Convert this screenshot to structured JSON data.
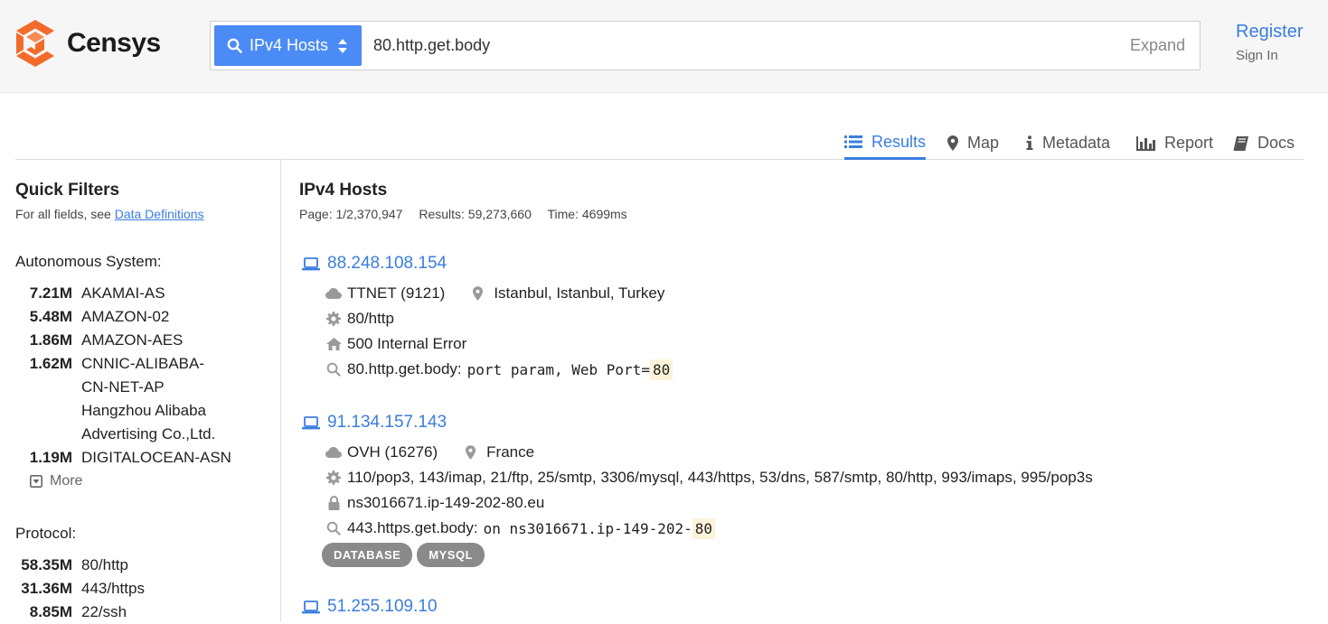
{
  "brand": {
    "name": "Censys",
    "colors": {
      "orange": "#f26b2b",
      "blue": "#4a8bf5",
      "link": "#3a7de0"
    }
  },
  "search": {
    "index_label": "IPv4 Hosts",
    "query": "80.http.get.body",
    "expand_label": "Expand"
  },
  "auth": {
    "register": "Register",
    "sign_in": "Sign In"
  },
  "tabs": [
    {
      "label": "Results",
      "icon": "list-icon",
      "active": true
    },
    {
      "label": "Map",
      "icon": "map-marker-icon"
    },
    {
      "label": "Metadata",
      "icon": "info-icon"
    },
    {
      "label": "Report",
      "icon": "bar-chart-icon"
    },
    {
      "label": "Docs",
      "icon": "book-icon"
    }
  ],
  "sidebar": {
    "title": "Quick Filters",
    "subtitle_prefix": "For all fields, see",
    "subtitle_link": "Data Definitions",
    "autonomous_system": {
      "title": "Autonomous System:",
      "items": [
        {
          "count": "7.21M",
          "name": "AKAMAI-AS"
        },
        {
          "count": "5.48M",
          "name": "AMAZON-02"
        },
        {
          "count": "1.86M",
          "name": "AMAZON-AES"
        },
        {
          "count": "1.62M",
          "name": "CNNIC-ALIBABA-CN-NET-AP Hangzhou Alibaba Advertising Co.,Ltd."
        },
        {
          "count": "1.19M",
          "name": "DIGITALOCEAN-ASN"
        }
      ],
      "more_label": "More"
    },
    "protocol": {
      "title": "Protocol:",
      "items": [
        {
          "count": "58.35M",
          "name": "80/http"
        },
        {
          "count": "31.36M",
          "name": "443/https"
        },
        {
          "count": "8.85M",
          "name": "22/ssh"
        }
      ]
    }
  },
  "main": {
    "title": "IPv4 Hosts",
    "page": "Page: 1/2,370,947",
    "results": "Results: 59,273,660",
    "time": "Time: 4699ms",
    "results_list": [
      {
        "ip": "88.248.108.154",
        "as": "TTNET (9121)",
        "location": "Istanbul, Istanbul, Turkey",
        "protocols": "80/http",
        "title": "500 Internal Error",
        "match_field": "80.http.get.body:",
        "match_text": "port param, Web Port=",
        "match_highlight": "80"
      },
      {
        "ip": "91.134.157.143",
        "as": "OVH (16276)",
        "location": "France",
        "protocols": "110/pop3, 143/imap, 21/ftp, 25/smtp, 3306/mysql, 443/https, 53/dns, 587/smtp, 80/http, 993/imaps, 995/pop3s",
        "hostname": "ns3016671.ip-149-202-80.eu",
        "match_field": "443.https.get.body:",
        "match_text": "on ns3016671.ip-149-202-",
        "match_highlight": "80",
        "tags": [
          "DATABASE",
          "MYSQL"
        ]
      },
      {
        "ip": "51.255.109.10"
      }
    ]
  }
}
